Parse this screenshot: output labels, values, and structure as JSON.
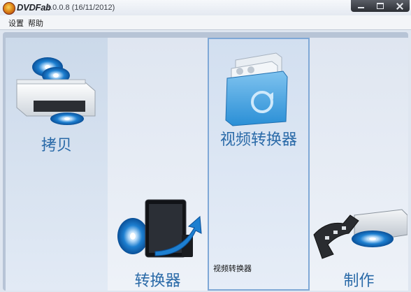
{
  "titlebar": {
    "app_name": "DVDFab",
    "version": "9.0.0.8 (16/11/2012)"
  },
  "menu": {
    "items": [
      {
        "label": "设置"
      },
      {
        "label": "帮助"
      }
    ]
  },
  "modules": [
    {
      "label": "拷贝"
    },
    {
      "label": "转换器"
    },
    {
      "label": "视频转换器"
    },
    {
      "label": "制作"
    }
  ],
  "tooltip": "视频转换器",
  "colors": {
    "label_blue": "#2a6aa8",
    "selected_border": "#7fa8d6",
    "disc_blue": "#1d7fd0"
  }
}
